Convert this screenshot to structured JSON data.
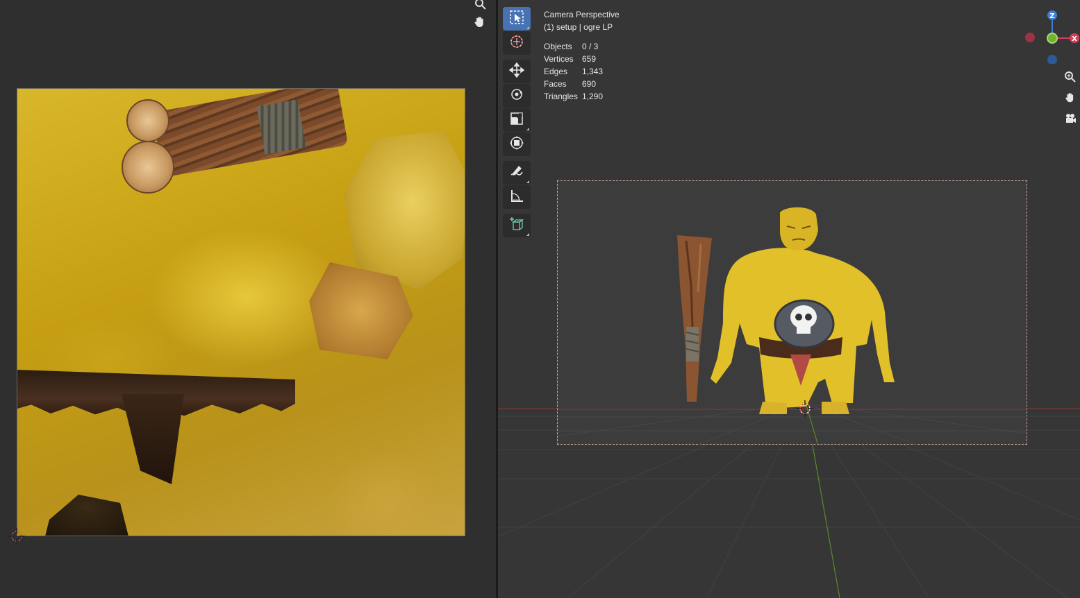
{
  "viewport": {
    "overlay": {
      "title": "Camera Perspective",
      "subtitle": "(1) setup | ogre LP",
      "stats": [
        {
          "label": "Objects",
          "value": "0 / 3"
        },
        {
          "label": "Vertices",
          "value": "659"
        },
        {
          "label": "Edges",
          "value": "1,343"
        },
        {
          "label": "Faces",
          "value": "690"
        },
        {
          "label": "Triangles",
          "value": "1,290"
        }
      ]
    },
    "gizmo": {
      "x_label": "X",
      "z_label": "Z"
    },
    "toolbar": {
      "active_tool": "select-box",
      "tools": [
        "select-box",
        "cursor",
        "move",
        "rotate",
        "scale",
        "transform",
        "annotate",
        "measure",
        "add-cube"
      ]
    }
  },
  "colors": {
    "accent": "#4772b3",
    "x_axis": "#d3405a",
    "y_axis": "#72b32c",
    "z_axis": "#3f7ed1"
  }
}
